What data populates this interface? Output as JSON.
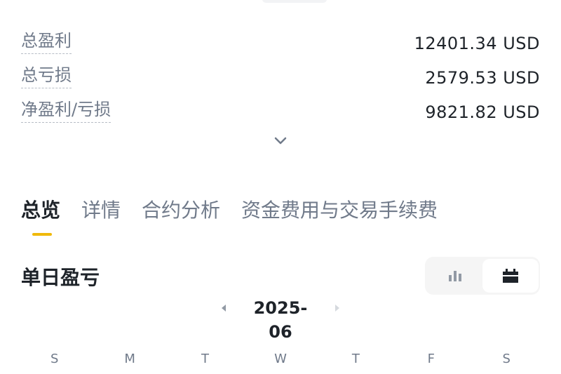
{
  "summary": {
    "rows": [
      {
        "label": "总盈利",
        "value": "12401.34 USD"
      },
      {
        "label": "总亏损",
        "value": "2579.53 USD"
      },
      {
        "label": "净盈利/亏损",
        "value": "9821.82 USD"
      }
    ]
  },
  "tabs": [
    "总览",
    "详情",
    "合约分析",
    "资金费用与交易手续费"
  ],
  "active_tab": "总览",
  "section": {
    "title": "单日盈亏"
  },
  "view_toggle": {
    "options": [
      "bar-chart-icon",
      "calendar-icon"
    ],
    "selected": "calendar-icon"
  },
  "calendar": {
    "month": "2025-06",
    "weekdays": [
      "S",
      "M",
      "T",
      "W",
      "T",
      "F",
      "S"
    ]
  },
  "colors": {
    "accent": "#F0B90B",
    "text_primary": "#1E2329",
    "text_secondary": "#707A8A"
  }
}
